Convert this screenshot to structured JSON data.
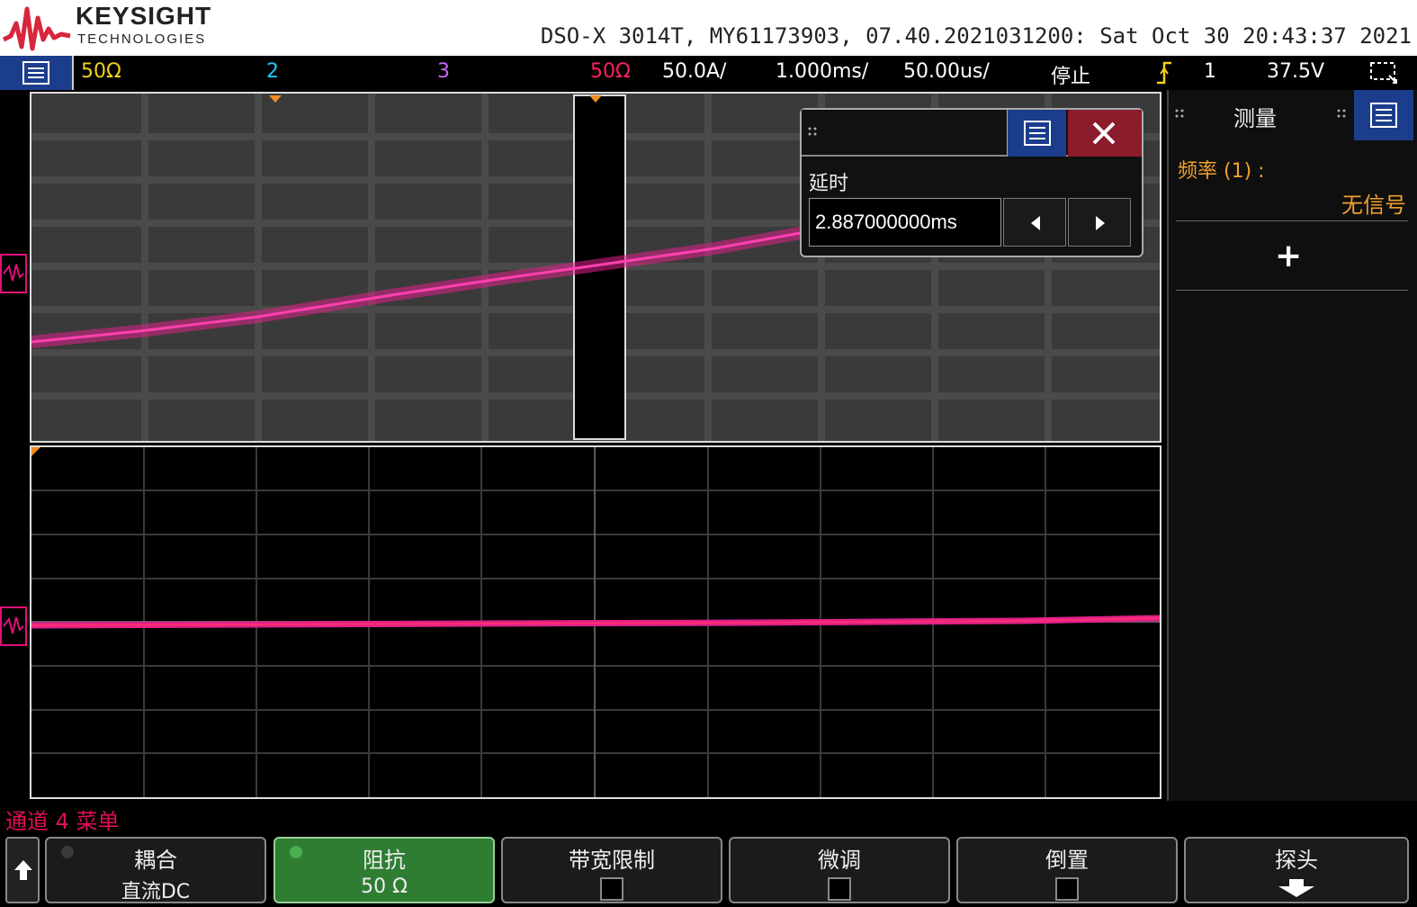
{
  "header": {
    "brand": "KEYSIGHT",
    "brand_sub": "TECHNOLOGIES",
    "device_info": "DSO-X 3014T, MY61173903, 07.40.2021031200: Sat Oct 30 20:43:37 2021"
  },
  "status": {
    "ch1_impedance": "50Ω",
    "ch2": "2",
    "ch3": "3",
    "ch4_impedance": "50Ω",
    "ch4_scale": "50.0A/",
    "timebase_main": "1.000ms/",
    "timebase_zoom": "50.00us/",
    "run_state": "停止",
    "trigger_channel": "1",
    "trigger_level": "37.5V",
    "colors": {
      "ch1": "#f0d020",
      "ch2": "#1ec8ff",
      "ch3": "#cc66ff",
      "ch4": "#ff2060"
    }
  },
  "delay_dialog": {
    "label": "延时",
    "value": "2.887000000ms"
  },
  "measure_panel": {
    "title": "测量",
    "item_label": "频率 (1) :",
    "item_value": "无信号",
    "add_symbol": "+"
  },
  "channel_menu": {
    "title": "通道 4 菜单",
    "softkeys": [
      {
        "label": "耦合",
        "value": "直流DC",
        "type": "value"
      },
      {
        "label": "阻抗",
        "value": "50 Ω",
        "type": "value",
        "active": true
      },
      {
        "label": "带宽限制",
        "type": "checkbox"
      },
      {
        "label": "微调",
        "type": "checkbox"
      },
      {
        "label": "倒置",
        "type": "checkbox"
      },
      {
        "label": "探头",
        "type": "submenu"
      }
    ]
  },
  "waveform_color": "#e0208a"
}
